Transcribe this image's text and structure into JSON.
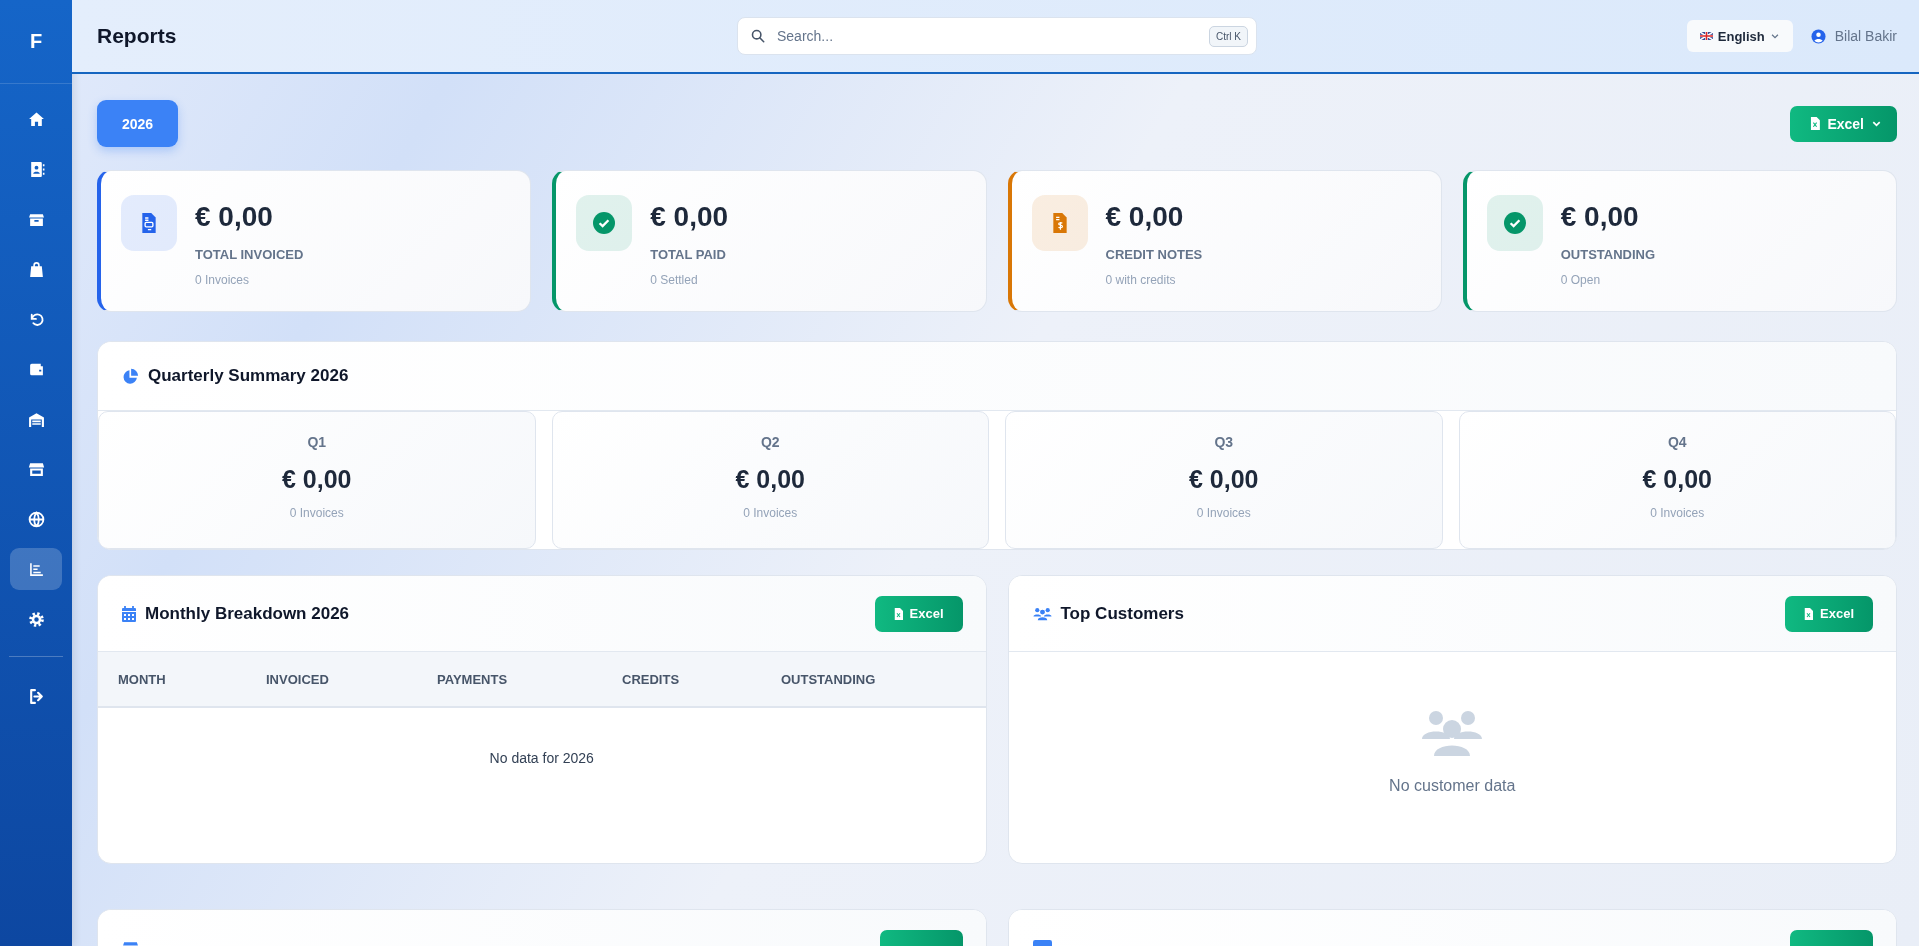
{
  "sidebar": {
    "logo": "F",
    "items": [
      {
        "selected": false
      },
      {
        "selected": false
      },
      {
        "selected": false
      },
      {
        "selected": false
      },
      {
        "selected": false
      },
      {
        "selected": false
      },
      {
        "selected": false
      },
      {
        "selected": false
      },
      {
        "selected": false
      },
      {
        "selected": true
      },
      {
        "selected": false
      }
    ],
    "bottom_items": [
      {
        "selected": false
      }
    ]
  },
  "header": {
    "title": "Reports",
    "search": {
      "placeholder": "Search...",
      "shortcut": "Ctrl K"
    },
    "language": "English",
    "user": "Bilal Bakir"
  },
  "toolbar": {
    "year": "2026",
    "export": "Excel"
  },
  "stats": [
    {
      "kind": "invoice",
      "color": "#2563eb",
      "amount": "€ 0,00",
      "label": "TOTAL INVOICED",
      "sub": "0 Invoices"
    },
    {
      "kind": "check",
      "color": "#059669",
      "amount": "€ 0,00",
      "label": "TOTAL PAID",
      "sub": "0 Settled"
    },
    {
      "kind": "credit",
      "color": "#d97706",
      "amount": "€ 0,00",
      "label": "CREDIT NOTES",
      "sub": "0 with credits"
    },
    {
      "kind": "check",
      "color": "#059669",
      "amount": "€ 0,00",
      "label": "OUTSTANDING",
      "sub": "0 Open"
    }
  ],
  "quarterly": {
    "title": "Quarterly Summary 2026",
    "quarters": [
      {
        "name": "Q1",
        "amount": "€ 0,00",
        "sub": "0 Invoices"
      },
      {
        "name": "Q2",
        "amount": "€ 0,00",
        "sub": "0 Invoices"
      },
      {
        "name": "Q3",
        "amount": "€ 0,00",
        "sub": "0 Invoices"
      },
      {
        "name": "Q4",
        "amount": "€ 0,00",
        "sub": "0 Invoices"
      }
    ]
  },
  "monthly": {
    "title": "Monthly Breakdown 2026",
    "export": "Excel",
    "columns": [
      "MONTH",
      "INVOICED",
      "PAYMENTS",
      "CREDITS",
      "OUTSTANDING"
    ],
    "empty": "No data for 2026"
  },
  "top_customers": {
    "title": "Top Customers",
    "export": "Excel",
    "empty": "No customer data"
  }
}
